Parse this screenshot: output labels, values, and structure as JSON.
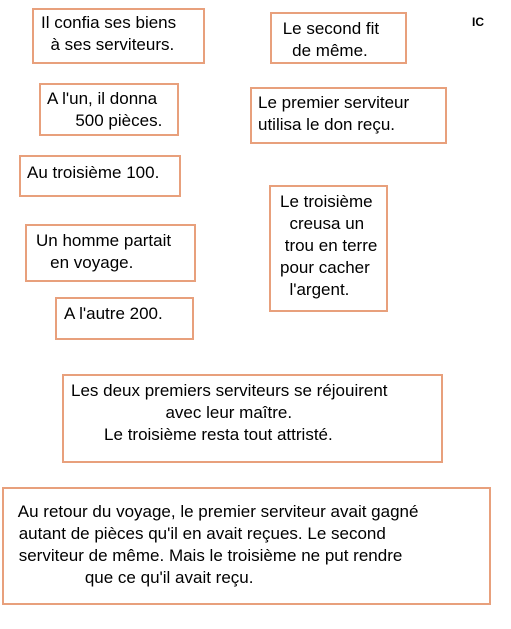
{
  "corner_label": "IC",
  "border_color": "#e8a07c",
  "cards": {
    "c1": "Il confia ses biens\n  à ses serviteurs.",
    "c2": " Le second fit\n   de même.",
    "c3": "A l'un, il donna\n      500 pièces.",
    "c4": "Le premier serviteur\nutilisa le don reçu.",
    "c5": "Au troisième 100.",
    "c6": "Le troisième\n  creusa un\n trou en terre\npour cacher\n  l'argent.",
    "c7": "Un homme partait\n   en voyage.",
    "c8": "A l'autre 200.",
    "c9": "Les deux premiers serviteurs se réjouirent\n                    avec leur maître.\n       Le troisième resta tout attristé.",
    "c10": " Au retour du voyage, le premier serviteur avait gagné\n autant de pièces qu'il en avait reçues. Le second\n serviteur de même. Mais le troisième ne put rendre\n               que ce qu'il avait reçu."
  }
}
